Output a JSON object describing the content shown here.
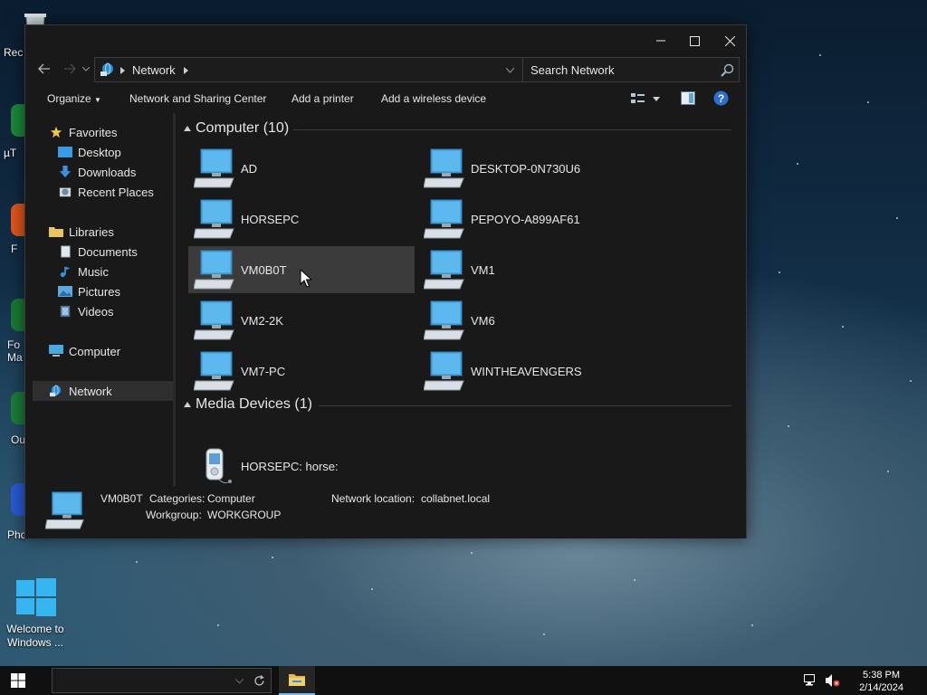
{
  "desktop": {
    "icons": [
      {
        "label": "Rec"
      },
      {
        "label": "µT"
      },
      {
        "label": "F"
      },
      {
        "label": "Fo\nMa"
      },
      {
        "label": "Ou"
      },
      {
        "label": "Pho"
      },
      {
        "label": "Welcome to\nWindows ..."
      }
    ]
  },
  "window": {
    "address": {
      "location": "Network"
    },
    "search": {
      "placeholder": "Search Network"
    },
    "commands": {
      "organize": "Organize",
      "network_sharing": "Network and Sharing Center",
      "add_printer": "Add a printer",
      "add_wireless": "Add a wireless device"
    },
    "nav": {
      "favorites": "Favorites",
      "desktop": "Desktop",
      "downloads": "Downloads",
      "recent_places": "Recent Places",
      "libraries": "Libraries",
      "documents": "Documents",
      "music": "Music",
      "pictures": "Pictures",
      "videos": "Videos",
      "computer": "Computer",
      "network": "Network"
    },
    "groups": {
      "computer": {
        "title": "Computer (10)",
        "items": [
          "AD",
          "DESKTOP-0N730U6",
          "HORSEPC",
          "PEPOYO-A899AF61",
          "VM0B0T",
          "VM1",
          "VM2-2K",
          "VM6",
          "VM7-PC",
          "WINTHEAVENGERS"
        ]
      },
      "media": {
        "title": "Media Devices (1)",
        "items": [
          "HORSEPC: horse:"
        ]
      }
    },
    "selected_item": "VM0B0T",
    "details": {
      "name": "VM0B0T",
      "categories_label": "Categories:",
      "categories_value": "Computer",
      "workgroup_label": "Workgroup:",
      "workgroup_value": "WORKGROUP",
      "location_label": "Network location:",
      "location_value": "collabnet.local"
    }
  },
  "taskbar": {
    "time": "5:38 PM",
    "date": "2/14/2024"
  },
  "colors": {
    "window_bg": "#191919",
    "selection": "#3b3b3b",
    "accent": "#76b9ed",
    "monitor_blue": "#4aa8e0"
  }
}
